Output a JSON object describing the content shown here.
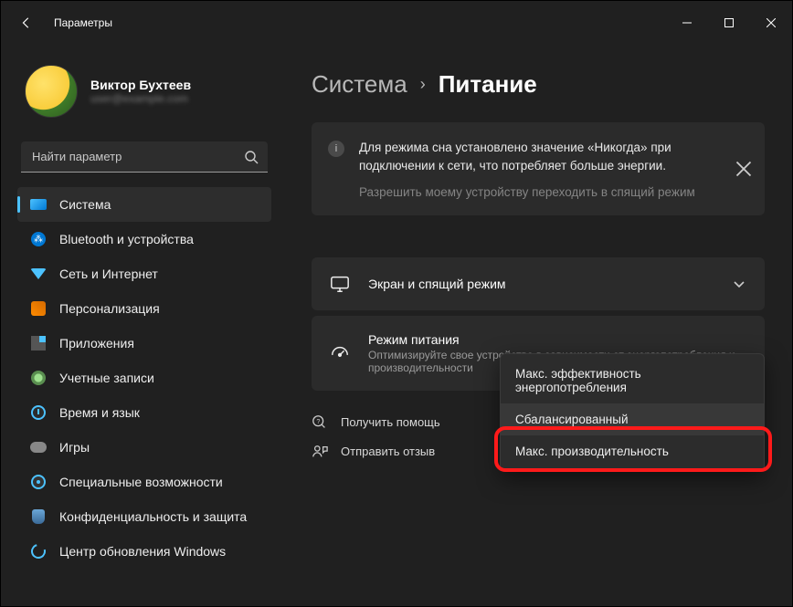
{
  "window": {
    "title": "Параметры"
  },
  "profile": {
    "name": "Виктор Бухтеев",
    "email": "user@example.com"
  },
  "search": {
    "placeholder": "Найти параметр"
  },
  "sidebar": {
    "items": [
      {
        "label": "Система"
      },
      {
        "label": "Bluetooth и устройства"
      },
      {
        "label": "Сеть и Интернет"
      },
      {
        "label": "Персонализация"
      },
      {
        "label": "Приложения"
      },
      {
        "label": "Учетные записи"
      },
      {
        "label": "Время и язык"
      },
      {
        "label": "Игры"
      },
      {
        "label": "Специальные возможности"
      },
      {
        "label": "Конфиденциальность и защита"
      },
      {
        "label": "Центр обновления Windows"
      }
    ]
  },
  "breadcrumb": {
    "parent": "Система",
    "current": "Питание"
  },
  "notice": {
    "text": "Для режима сна установлено значение «Никогда» при подключении к сети, что потребляет больше энергии.",
    "link": "Разрешить моему устройству переходить в спящий режим"
  },
  "cards": {
    "screen": {
      "title": "Экран и спящий режим"
    },
    "power": {
      "title": "Режим питания",
      "sub": "Оптимизируйте свое устройство в зависимости от энергопотребления и производительности"
    }
  },
  "dropdown": {
    "items": [
      "Макс. эффективность энергопотребления",
      "Сбалансированный",
      "Макс. производительность"
    ]
  },
  "footer": {
    "help": "Получить помощь",
    "feedback": "Отправить отзыв"
  }
}
